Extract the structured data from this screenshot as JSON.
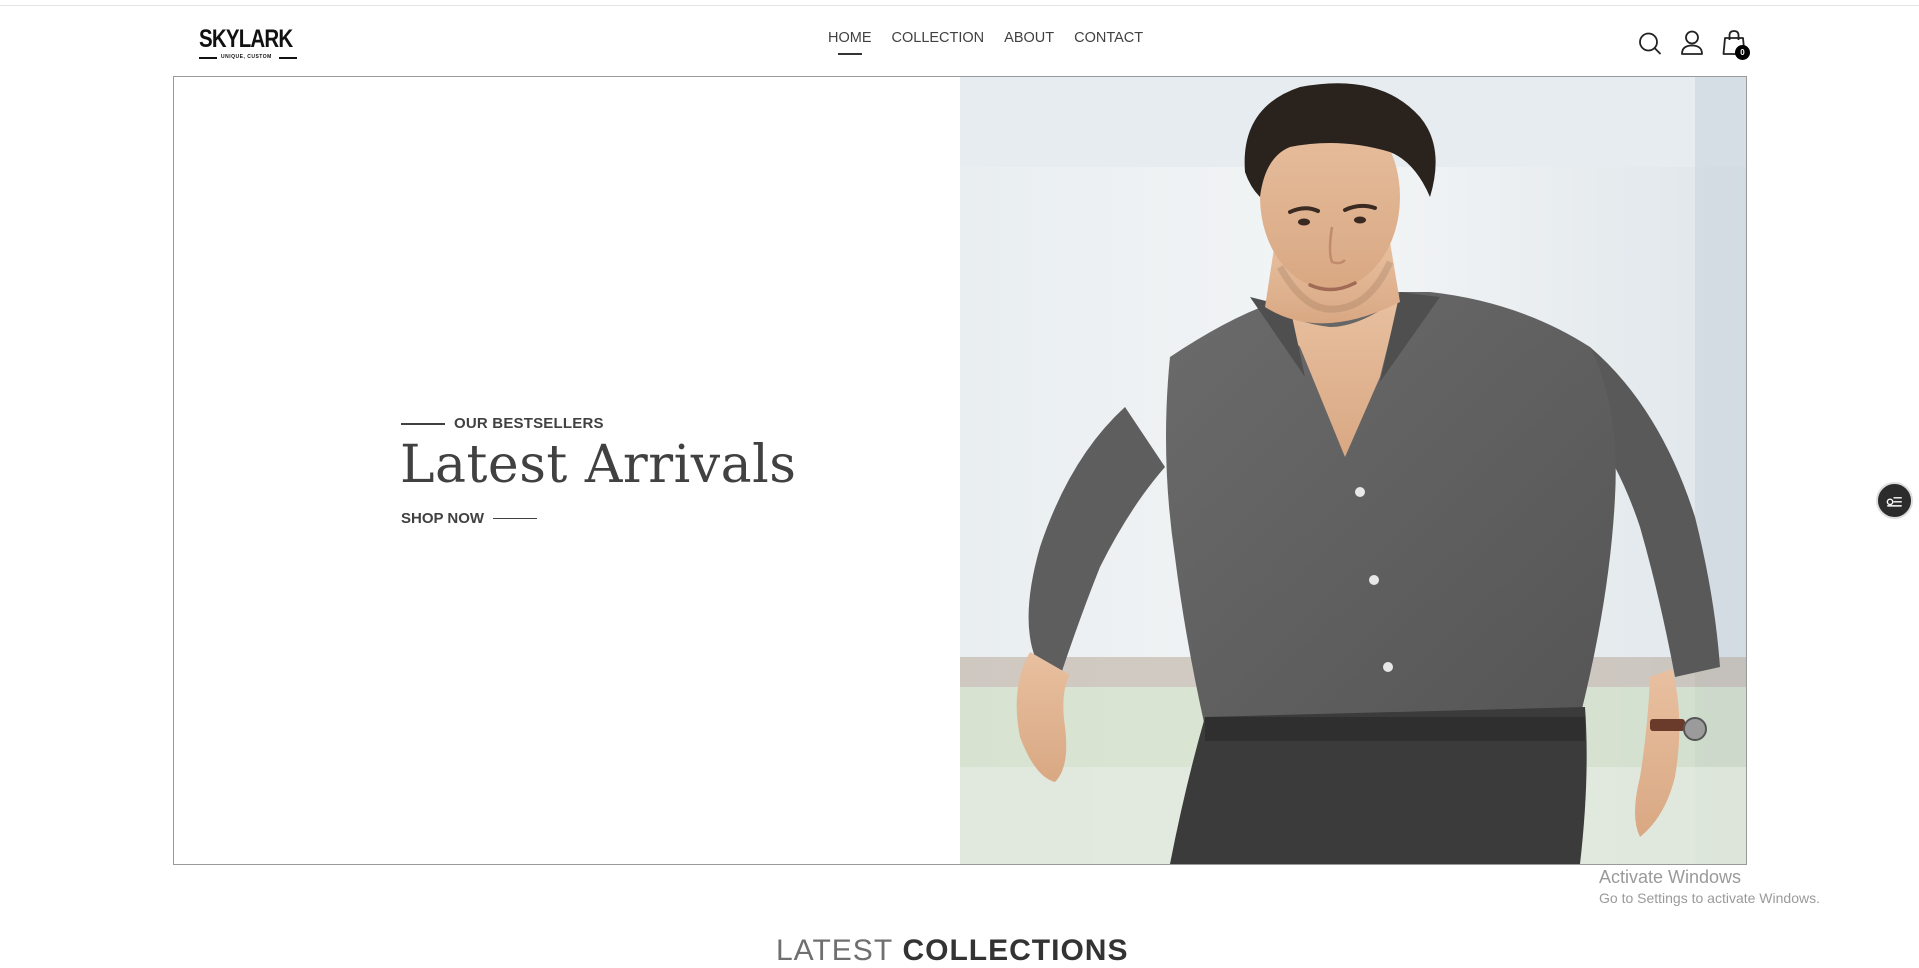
{
  "header": {
    "logo_text": "SKYLARK",
    "logo_tagline": "UNIQUE, CUSTOM",
    "nav": [
      {
        "label": "HOME",
        "active": true
      },
      {
        "label": "COLLECTION",
        "active": false
      },
      {
        "label": "ABOUT",
        "active": false
      },
      {
        "label": "CONTACT",
        "active": false
      }
    ],
    "icons": [
      "search-icon",
      "user-icon",
      "shopping-bag-icon"
    ],
    "cart_count": "0"
  },
  "hero": {
    "eyebrow": "OUR BESTSELLERS",
    "title": "Latest Arrivals",
    "cta": "SHOP NOW",
    "image_subject": "man-in-grey-shirt-photo"
  },
  "section": {
    "heading_light": "LATEST",
    "heading_dark": "COLLECTIONS"
  },
  "watermark": {
    "title": "Activate Windows",
    "subtitle": "Go to Settings to activate Windows."
  },
  "floating_button": {
    "icon": "settings-list-icon"
  },
  "colors": {
    "text": "#414141",
    "border": "#9a9a9a",
    "badge": "#000000",
    "float_btn": "#2c2c2c"
  }
}
